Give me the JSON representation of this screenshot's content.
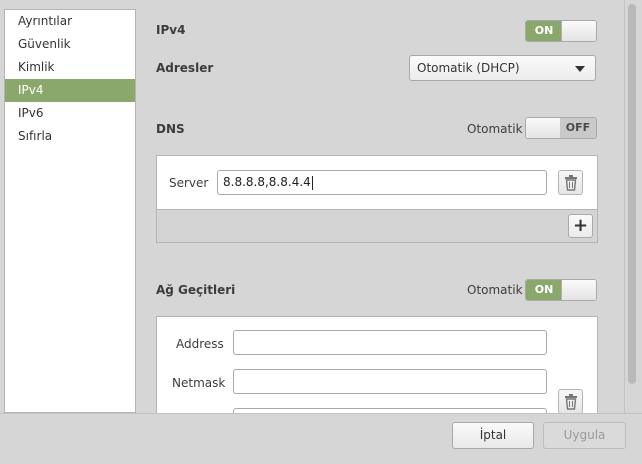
{
  "sidebar": {
    "items": [
      {
        "label": "Ayrıntılar"
      },
      {
        "label": "Güvenlik"
      },
      {
        "label": "Kimlik"
      },
      {
        "label": "IPv4"
      },
      {
        "label": "IPv6"
      },
      {
        "label": "Sıfırla"
      }
    ],
    "selected_index": 3
  },
  "ipv4": {
    "title": "IPv4",
    "switch_state": "ON"
  },
  "addresses": {
    "label": "Adresler",
    "method_selected": "Otomatik (DHCP)"
  },
  "dns": {
    "title": "DNS",
    "auto_label": "Otomatik",
    "auto_switch_state": "OFF",
    "server_label": "Server",
    "server_value": "8.8.8.8,8.8.4.4"
  },
  "gateways": {
    "title": "Ağ Geçitleri",
    "auto_label": "Otomatik",
    "auto_switch_state": "ON",
    "address_label": "Address",
    "address_value": "",
    "netmask_label": "Netmask",
    "netmask_value": "",
    "gateway_value": ""
  },
  "footer": {
    "cancel_label": "İptal",
    "apply_label": "Uygula"
  },
  "colors": {
    "accent": "#8aa86b",
    "background": "#d6d6d6"
  },
  "icons": {
    "delete": "trash-icon",
    "add": "plus-icon",
    "dropdown": "chevron-down-icon"
  }
}
